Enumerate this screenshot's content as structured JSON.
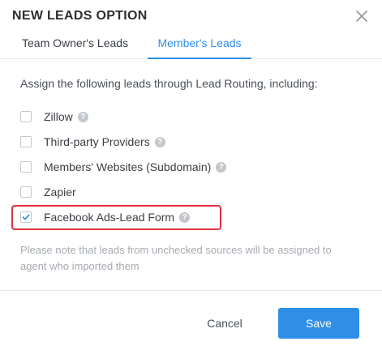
{
  "dialog": {
    "title": "NEW LEADS OPTION",
    "close_icon": "close-icon"
  },
  "tabs": [
    {
      "label": "Team Owner's Leads",
      "active": false
    },
    {
      "label": "Member's Leads",
      "active": true
    }
  ],
  "intro": "Assign the following leads through Lead Routing, including:",
  "options": [
    {
      "label": "Zillow",
      "checked": false,
      "help_icon": "question-icon",
      "help_glyph": "?"
    },
    {
      "label": "Third-party Providers",
      "checked": false,
      "help_icon": "question-icon",
      "help_glyph": "?"
    },
    {
      "label": "Members' Websites (Subdomain)",
      "checked": false,
      "help_icon": "question-icon",
      "help_glyph": "?"
    },
    {
      "label": "Zapier",
      "checked": false
    },
    {
      "label": "Facebook Ads-Lead Form",
      "checked": true,
      "help_icon": "question-icon",
      "help_glyph": "?",
      "highlighted": true
    }
  ],
  "note": "Please note that leads from unchecked sources will be assigned to agent who imported them",
  "footer": {
    "cancel_label": "Cancel",
    "save_label": "Save"
  },
  "colors": {
    "accent": "#2f8fe6",
    "highlight_border": "#e0323c",
    "note_text": "#a6abb0"
  }
}
